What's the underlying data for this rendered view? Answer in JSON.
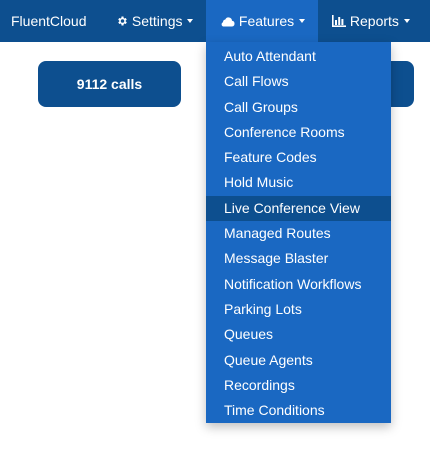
{
  "navbar": {
    "brand": "FluentCloud",
    "settings": "Settings",
    "features": "Features",
    "reports": "Reports"
  },
  "stats": {
    "calls": "9112 calls"
  },
  "features_menu": {
    "active_index": 6,
    "items": [
      "Auto Attendant",
      "Call Flows",
      "Call Groups",
      "Conference Rooms",
      "Feature Codes",
      "Hold Music",
      "Live Conference View",
      "Managed Routes",
      "Message Blaster",
      "Notification Workflows",
      "Parking Lots",
      "Queues",
      "Queue Agents",
      "Recordings",
      "Time Conditions"
    ]
  },
  "colors": {
    "navbar_bg": "#0d4f8f",
    "menu_bg": "#1a68c2",
    "menu_active_bg": "#0d4f8f"
  }
}
